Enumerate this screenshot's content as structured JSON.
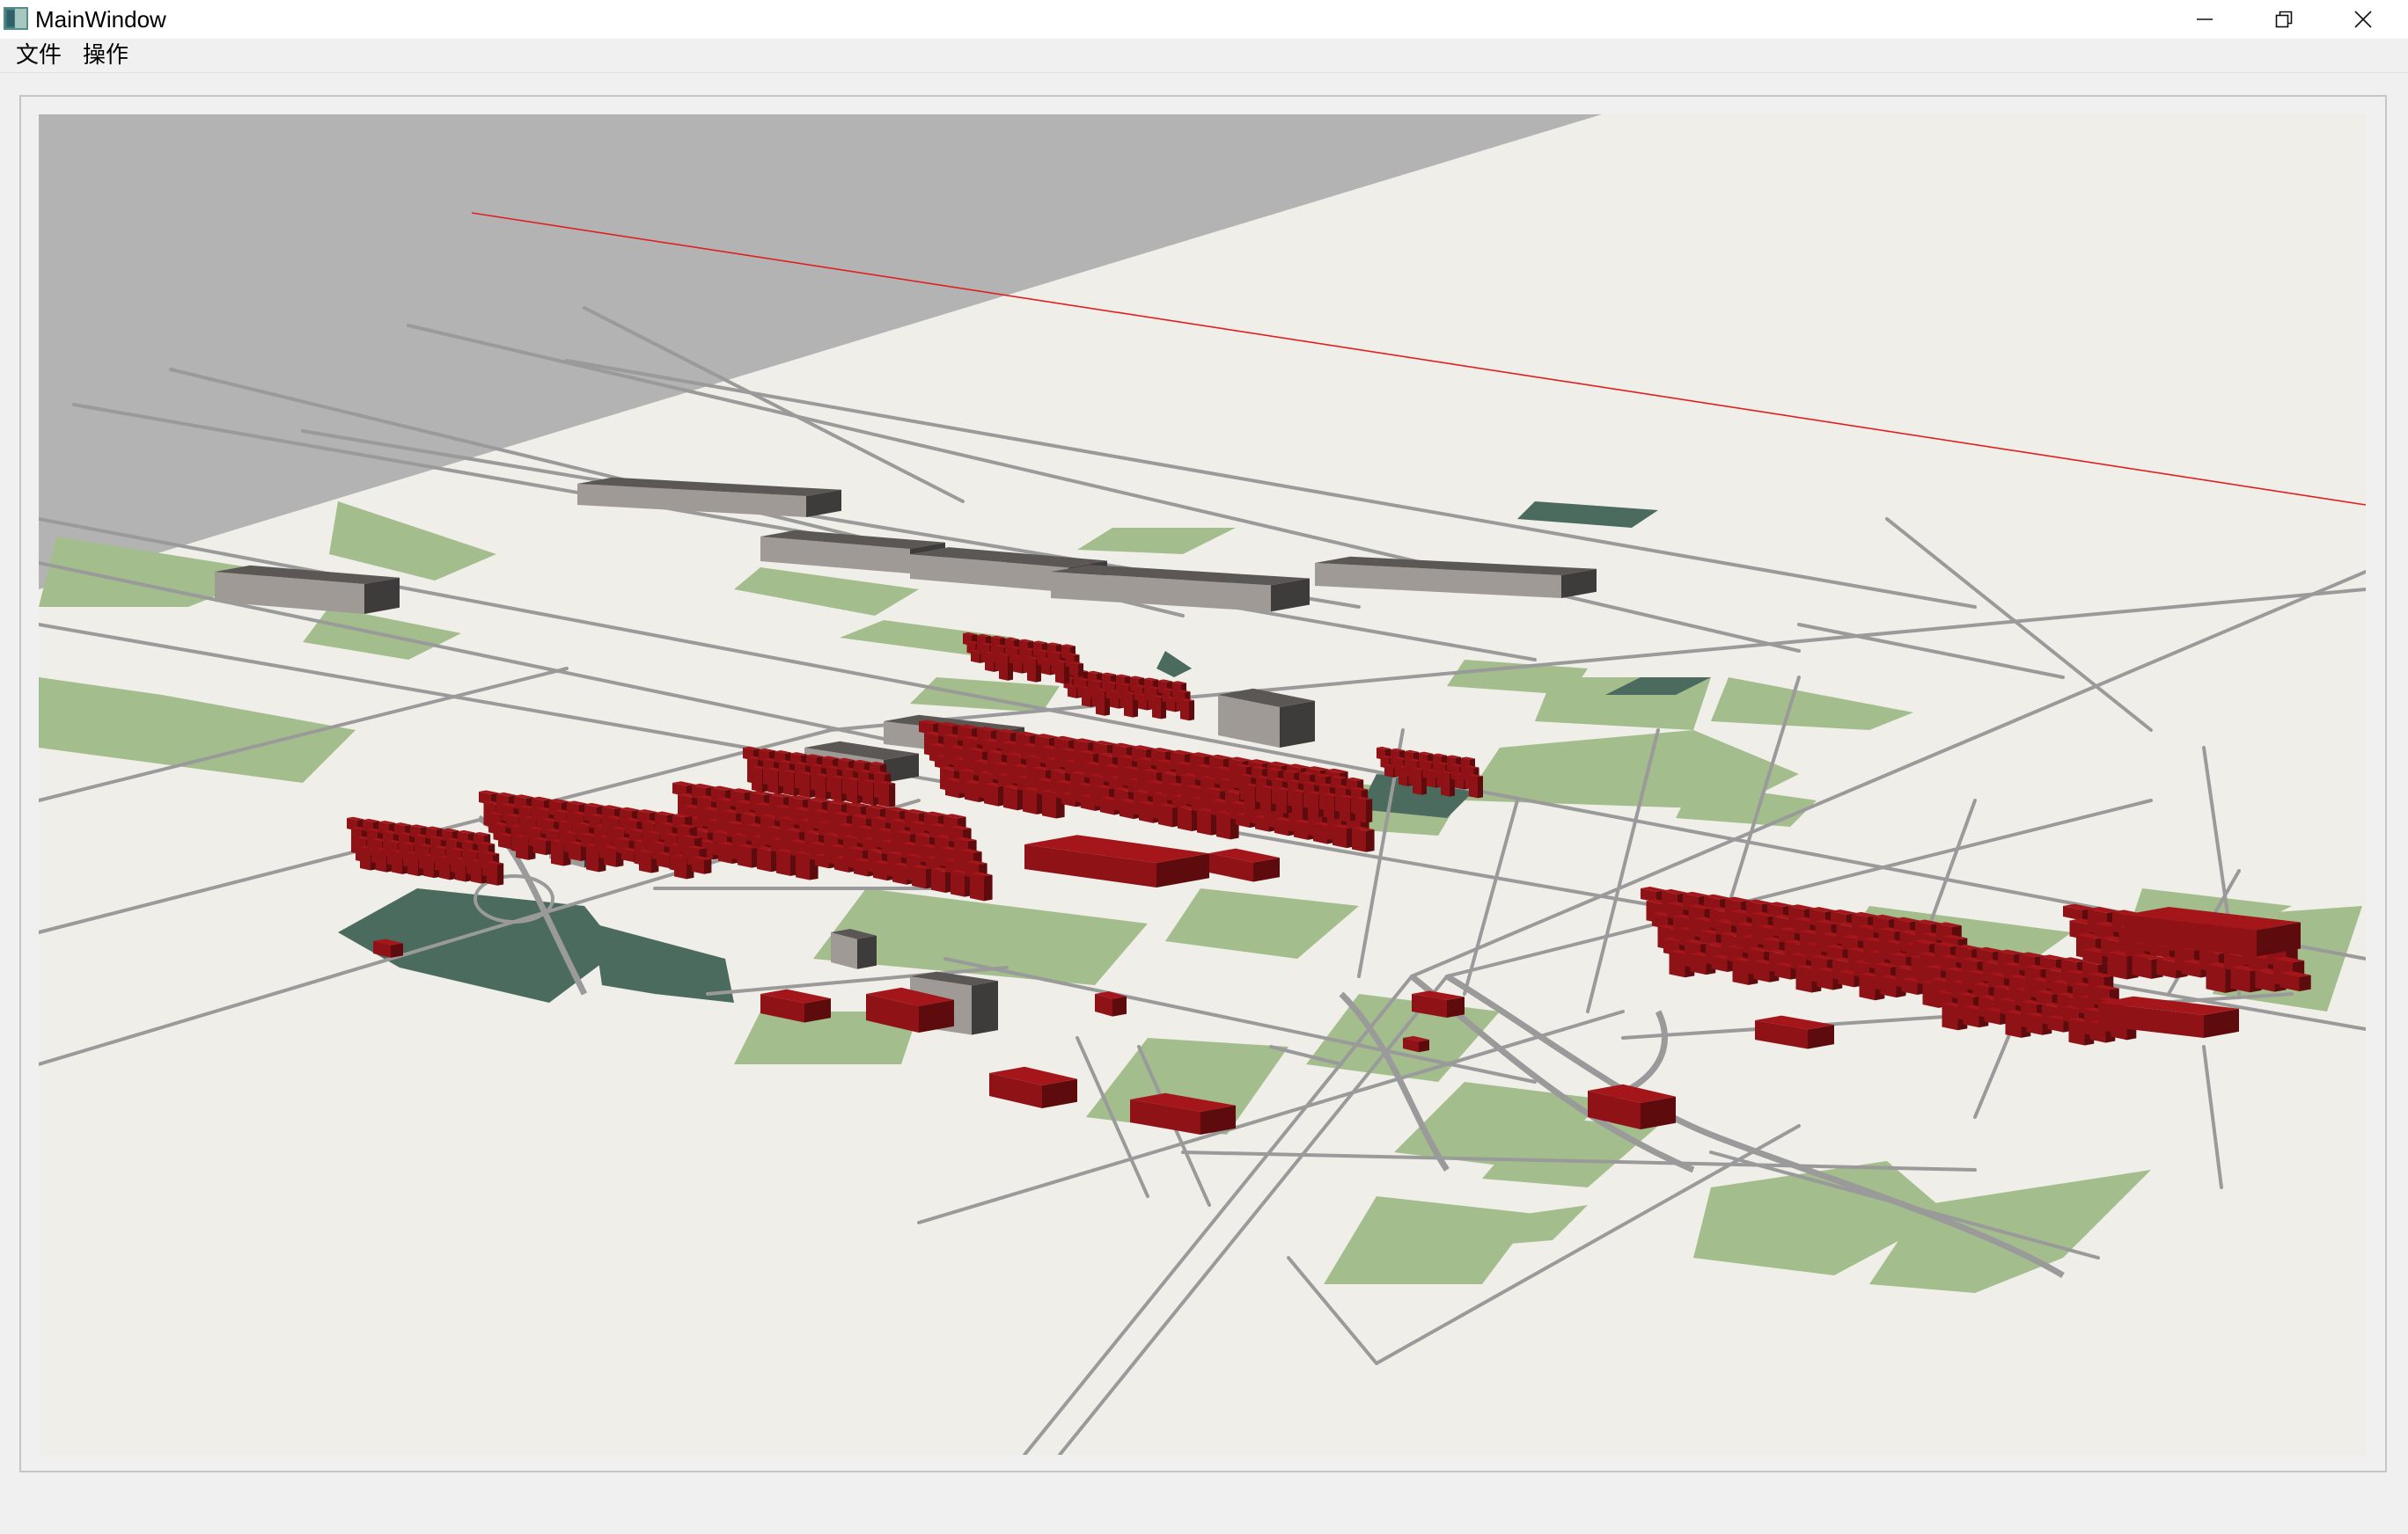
{
  "window": {
    "title": "MainWindow",
    "controls": {
      "minimize_icon": "minimize-icon",
      "restore_icon": "restore-icon",
      "close_icon": "close-icon"
    }
  },
  "menubar": {
    "items": [
      {
        "label": "文件"
      },
      {
        "label": "操作"
      }
    ]
  },
  "scene": {
    "colors": {
      "background_plane": "#f0eee9",
      "sky": "#b3b3b3",
      "roads": "#9a9a9a",
      "parks": "#a3bd8c",
      "dark_green": "#4b6b5e",
      "highlighted_buildings": "#8e1216",
      "gray_buildings": "#5a5755",
      "axis_line": "#e02020"
    }
  }
}
